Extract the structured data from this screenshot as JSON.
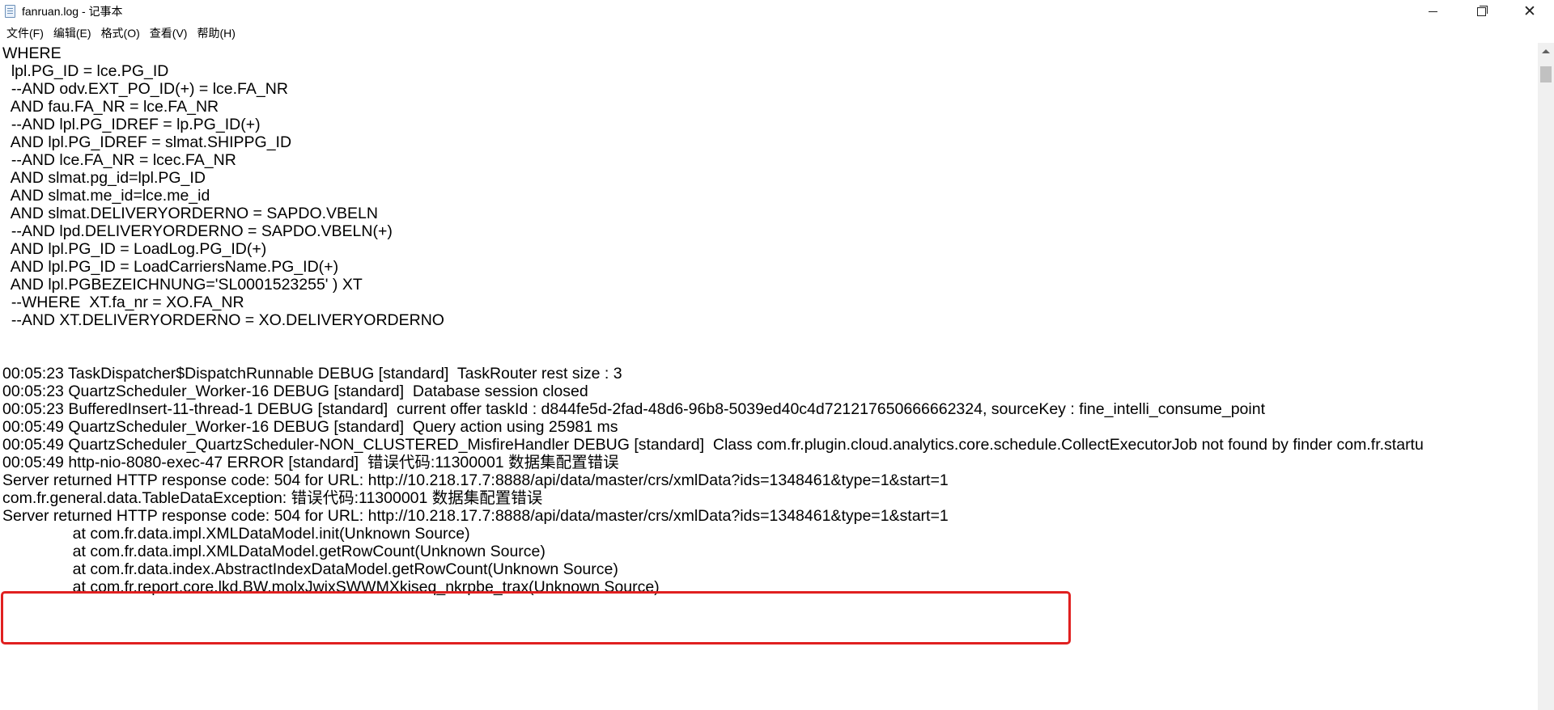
{
  "window": {
    "title": "fanruan.log - 记事本",
    "icon": "notepad-icon",
    "controls": {
      "minimize": "minimize-icon",
      "maximize": "restore-icon",
      "close": "close-icon"
    }
  },
  "menu": [
    "文件(F)",
    "编辑(E)",
    "格式(O)",
    "查看(V)",
    "帮助(H)"
  ],
  "lines": [
    "WHERE",
    "  lpl.PG_ID = lce.PG_ID",
    "  --AND odv.EXT_PO_ID(+) = lce.FA_NR",
    "  AND fau.FA_NR = lce.FA_NR",
    "  --AND lpl.PG_IDREF = lp.PG_ID(+)",
    "  AND lpl.PG_IDREF = slmat.SHIPPG_ID",
    "  --AND lce.FA_NR = lcec.FA_NR",
    "  AND slmat.pg_id=lpl.PG_ID",
    "  AND slmat.me_id=lce.me_id",
    "  AND slmat.DELIVERYORDERNO = SAPDO.VBELN",
    "  --AND lpd.DELIVERYORDERNO = SAPDO.VBELN(+)",
    "  AND lpl.PG_ID = LoadLog.PG_ID(+)",
    "  AND lpl.PG_ID = LoadCarriersName.PG_ID(+)",
    "  AND lpl.PGBEZEICHNUNG='SL0001523255' ) XT",
    "  --WHERE  XT.fa_nr = XO.FA_NR",
    "  --AND XT.DELIVERYORDERNO = XO.DELIVERYORDERNO",
    "",
    "",
    "00:05:23 TaskDispatcher$DispatchRunnable DEBUG [standard]  TaskRouter rest size : 3",
    "00:05:23 QuartzScheduler_Worker-16 DEBUG [standard]  Database session closed",
    "00:05:23 BufferedInsert-11-thread-1 DEBUG [standard]  current offer taskId : d844fe5d-2fad-48d6-96b8-5039ed40c4d721217650666662324, sourceKey : fine_intelli_consume_point",
    "00:05:49 QuartzScheduler_Worker-16 DEBUG [standard]  Query action using 25981 ms",
    "00:05:49 QuartzScheduler_QuartzScheduler-NON_CLUSTERED_MisfireHandler DEBUG [standard]  Class com.fr.plugin.cloud.analytics.core.schedule.CollectExecutorJob not found by finder com.fr.startu",
    "00:05:49 http-nio-8080-exec-47 ERROR [standard]  错误代码:11300001 数据集配置错误",
    "Server returned HTTP response code: 504 for URL: http://10.218.17.7:8888/api/data/master/crs/xmlData?ids=1348461&type=1&start=1",
    "com.fr.general.data.TableDataException: 错误代码:11300001 数据集配置错误",
    "Server returned HTTP response code: 504 for URL: http://10.218.17.7:8888/api/data/master/crs/xmlData?ids=1348461&type=1&start=1",
    "                at com.fr.data.impl.XMLDataModel.init(Unknown Source)",
    "                at com.fr.data.impl.XMLDataModel.getRowCount(Unknown Source)",
    "                at com.fr.data.index.AbstractIndexDataModel.getRowCount(Unknown Source)",
    "                at com.fr.report.core.lkd.BW.molxJwixSWWMXkiseq_nkrpbe_trax(Unknown Source)"
  ],
  "highlight": {
    "color": "#e02020"
  }
}
